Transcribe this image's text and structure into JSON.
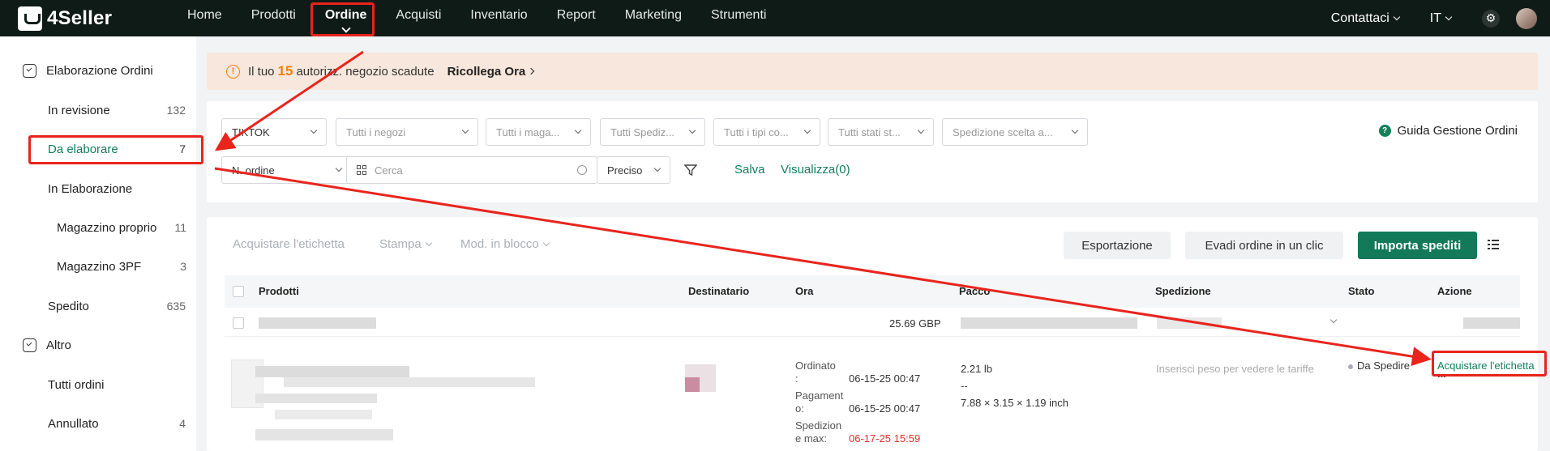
{
  "app": {
    "logo_text": "4Seller"
  },
  "nav": {
    "items": [
      "Home",
      "Prodotti",
      "Ordine",
      "Acquisti",
      "Inventario",
      "Report",
      "Marketing",
      "Strumenti"
    ],
    "active": "Ordine",
    "contact": "Contattaci",
    "language": "IT",
    "settings_icon": "gear-icon"
  },
  "sidebar": {
    "group1": "Elaborazione Ordini",
    "in_revisione": {
      "label": "In revisione",
      "count": "132"
    },
    "da_elaborare": {
      "label": "Da elaborare",
      "count": "7"
    },
    "in_elaborazione": {
      "label": "In Elaborazione"
    },
    "magazzino_proprio": {
      "label": "Magazzino proprio",
      "count": "11"
    },
    "magazzino_3pf": {
      "label": "Magazzino 3PF",
      "count": "3"
    },
    "spedito": {
      "label": "Spedito",
      "count": "635"
    },
    "group2": "Altro",
    "tutti_ordini": {
      "label": "Tutti ordini"
    },
    "annullato": {
      "label": "Annullato",
      "count": "4"
    }
  },
  "banner": {
    "prefix": "Il tuo",
    "number": "15",
    "suffix": "autorizz. negozio scadute",
    "link": "Ricollega Ora"
  },
  "filters": {
    "platform": "TIKTOK",
    "shops": "Tutti i negozi",
    "warehouses": "Tutti i maga...",
    "shipping": "Tutti Spediz...",
    "types": "Tutti i tipi co...",
    "statuses": "Tutti stati st...",
    "ship_choice": "Spedizione scelta a...",
    "guide": "Guida Gestione Ordini",
    "search_field": "N. ordine",
    "search_placeholder": "Cerca",
    "match": "Preciso",
    "save": "Salva",
    "view": "Visualizza(0)"
  },
  "toolbar": {
    "buy_label": "Acquistare l'etichetta",
    "print": "Stampa",
    "bulk": "Mod. in blocco",
    "export": "Esportazione",
    "one_click": "Evadi ordine in un clic",
    "import": "Importa spediti"
  },
  "table": {
    "headers": {
      "products": "Prodotti",
      "recipient": "Destinatario",
      "time": "Ora",
      "package": "Pacco",
      "shipping": "Spedizione",
      "status": "Stato",
      "action": "Azione"
    },
    "sub_row": {
      "amount": "25.69 GBP"
    },
    "order": {
      "ordered_label_1": "Ordinato",
      "ordered_label_2": ":",
      "ordered_value": "06-15-25 00:47",
      "paid_label_1": "Pagament",
      "paid_label_2": "o:",
      "paid_value": "06-15-25 00:47",
      "shipmax_label_1": "Spedizion",
      "shipmax_label_2": "e max:",
      "shipmax_value": "06-17-25 15:59",
      "weight": "2.21 lb",
      "dash": "--",
      "dimensions": "7.88 × 3.15 × 1.19 inch",
      "shipping_hint": "Inserisci peso per vedere le tariffe",
      "status": "Da Spedire",
      "action": "Acquistare l'etichetta",
      "more": "..."
    }
  },
  "colors": {
    "accent": "#13805a",
    "highlight": "#e8241c",
    "warning": "#f0820f"
  }
}
